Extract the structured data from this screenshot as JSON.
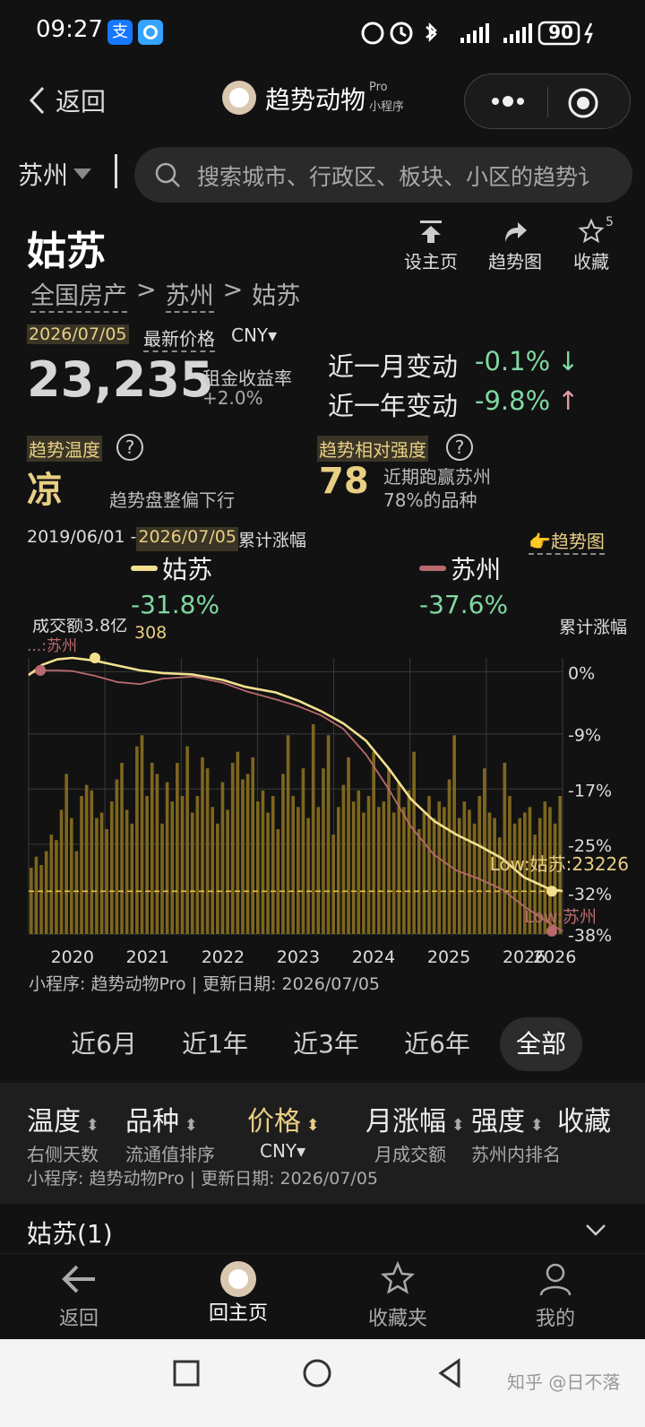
{
  "status_bar": {
    "time": "09:27",
    "battery": "90"
  },
  "nav": {
    "back_label": "返回",
    "title": "趋势动物",
    "title_sup": "Pro",
    "title_sub": "小程序"
  },
  "search": {
    "city": "苏州",
    "placeholder": "搜索城市、行政区、板块、小区的趋势讠"
  },
  "header": {
    "name": "姑苏",
    "actions": {
      "set_home": "设主页",
      "trend": "趋势图",
      "favorite": "收藏",
      "fav_count": "5"
    },
    "breadcrumb": [
      "全国房产",
      ">",
      "苏州",
      ">",
      "姑苏"
    ]
  },
  "price": {
    "date": "2026/07/05",
    "latest_label": "最新价格",
    "currency": "CNY▾",
    "value": "23,235",
    "yield_label": "租金收益率",
    "yield_value": "+2.0%",
    "month_label": "近一月变动",
    "month_value": "-0.1%",
    "month_arrow": "↓",
    "year_label": "近一年变动",
    "year_value": "-9.8%",
    "year_arrow": "↑"
  },
  "trend": {
    "temp_label": "趋势温度",
    "temp_value": "凉",
    "temp_desc": "趋势盘整偏下行",
    "strength_label": "趋势相对强度",
    "strength_value": "78",
    "strength_desc1": "近期跑赢苏州",
    "strength_desc2": "78%的品种"
  },
  "cumulative": {
    "range_start": "2019/06/01 -",
    "range_end": "2026/07/05",
    "range_suffix": "累计涨幅",
    "link": "👉趋势图",
    "legend": [
      {
        "name": "姑苏",
        "value": "-31.8%",
        "color": "#f3e08f"
      },
      {
        "name": "苏州",
        "value": "-37.6%",
        "color": "#b86a6e"
      }
    ]
  },
  "chart_data": {
    "type": "line",
    "title": "",
    "ylabel": "累计涨幅",
    "volume_label": "成交额3.8亿",
    "overlap_label": "308",
    "x_ticks": [
      "2020",
      "2021",
      "2022",
      "2023",
      "2024",
      "2025",
      "2026",
      "2026"
    ],
    "y_ticks": [
      "0%",
      "-9%",
      "-17%",
      "-25%",
      "-32%",
      "-38%"
    ],
    "ylim": [
      -38,
      2
    ],
    "x": [
      2019.42,
      2019.6,
      2019.8,
      2020.0,
      2020.3,
      2020.6,
      2020.9,
      2021.2,
      2021.6,
      2022.0,
      2022.3,
      2022.7,
      2023.0,
      2023.3,
      2023.6,
      2023.9,
      2024.2,
      2024.5,
      2024.8,
      2025.1,
      2025.4,
      2025.7,
      2026.0,
      2026.3,
      2026.51
    ],
    "series": [
      {
        "name": "姑苏",
        "color": "#f3e08f",
        "values": [
          -0.5,
          1.0,
          1.8,
          2.0,
          1.6,
          0.9,
          0.2,
          -0.2,
          -0.4,
          -1.2,
          -2.2,
          -3.0,
          -4.2,
          -5.7,
          -7.5,
          -10.0,
          -14.0,
          -18.5,
          -21.6,
          -23.6,
          -25.2,
          -27.0,
          -29.8,
          -31.3,
          -31.8
        ]
      },
      {
        "name": "苏州",
        "color": "#b86a6e",
        "values": [
          -0.3,
          0.2,
          0.2,
          0.1,
          -0.6,
          -1.5,
          -1.8,
          -1.0,
          -0.7,
          -1.6,
          -2.8,
          -4.0,
          -5.0,
          -6.3,
          -8.3,
          -12.0,
          -17.0,
          -22.5,
          -26.5,
          -28.8,
          -30.0,
          -31.5,
          -34.0,
          -36.2,
          -37.6
        ]
      }
    ],
    "low_labels": {
      "gusu": "Low:姑苏:23226",
      "suzhou": "Low:苏州"
    },
    "high_label": "...:苏州",
    "volume": [
      0.24,
      0.28,
      0.25,
      0.3,
      0.36,
      0.34,
      0.45,
      0.58,
      0.42,
      0.3,
      0.5,
      0.54,
      0.52,
      0.42,
      0.44,
      0.38,
      0.48,
      0.56,
      0.62,
      0.45,
      0.4,
      0.68,
      0.72,
      0.5,
      0.62,
      0.58,
      0.4,
      0.55,
      0.48,
      0.62,
      0.5,
      0.68,
      0.44,
      0.5,
      0.64,
      0.6,
      0.46,
      0.4,
      0.55,
      0.45,
      0.62,
      0.66,
      0.56,
      0.58,
      0.64,
      0.48,
      0.52,
      0.44,
      0.5,
      0.38,
      0.58,
      0.72,
      0.5,
      0.46,
      0.6,
      0.42,
      0.76,
      0.46,
      0.6,
      0.72,
      0.36,
      0.46,
      0.54,
      0.64,
      0.48,
      0.52,
      0.44,
      0.5,
      0.66,
      0.46,
      0.48,
      0.6,
      0.44,
      0.55,
      0.46,
      0.52,
      0.66,
      0.38,
      0.44,
      0.5,
      0.42,
      0.48,
      0.46,
      0.56,
      0.72,
      0.42,
      0.48,
      0.45,
      0.4,
      0.5,
      0.6,
      0.44,
      0.42,
      0.35,
      0.62,
      0.5,
      0.4,
      0.42,
      0.44,
      0.46,
      0.36,
      0.42,
      0.48,
      0.46,
      0.4,
      0.5
    ],
    "footer": "小程序: 趋势动物Pro | 更新日期: 2026/07/05"
  },
  "ranges": [
    "近6月",
    "近1年",
    "近3年",
    "近6年",
    "全部"
  ],
  "active_range": "全部",
  "table": {
    "cols": [
      {
        "top": "温度",
        "bottom": "右侧天数"
      },
      {
        "top": "品种",
        "bottom": "流通值排序"
      },
      {
        "top": "价格",
        "bottom": "CNY▾"
      },
      {
        "top": "月涨幅",
        "bottom": "月成交额"
      },
      {
        "top": "强度",
        "bottom": "苏州内排名"
      },
      {
        "top": "收藏",
        "bottom": ""
      }
    ],
    "footer": "小程序: 趋势动物Pro | 更新日期: 2026/07/05",
    "group": "姑苏(1)"
  },
  "tabs": [
    "返回",
    "回主页",
    "收藏夹",
    "我的"
  ],
  "watermark": "知乎 @日不落"
}
